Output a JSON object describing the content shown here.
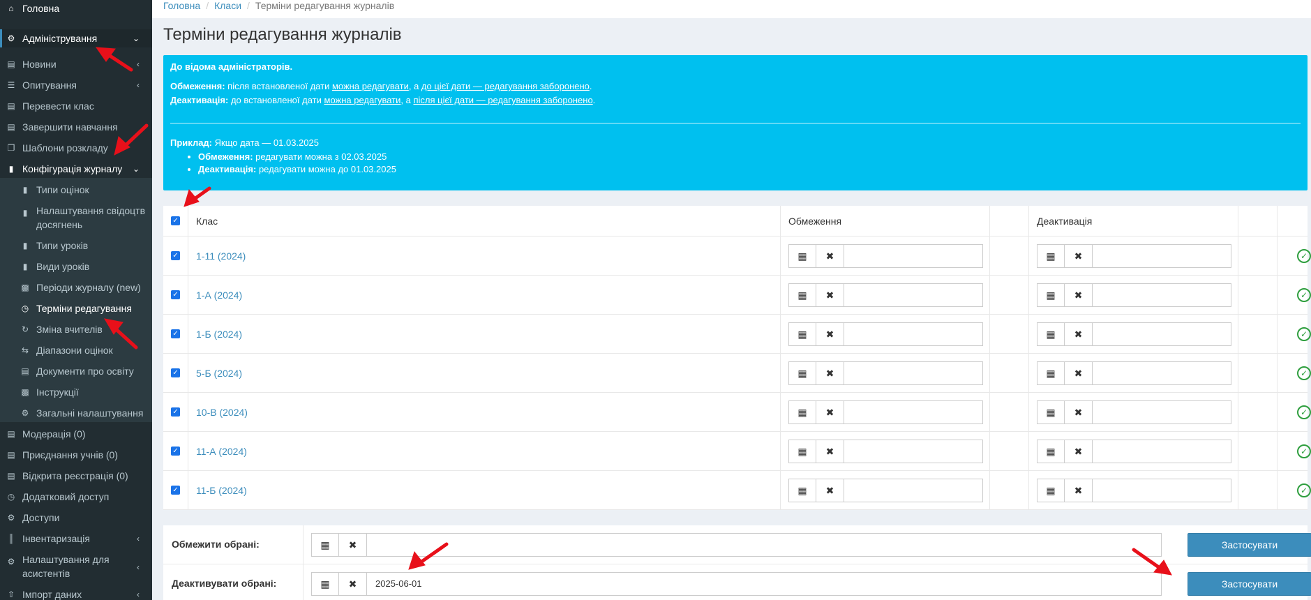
{
  "sidebar": {
    "items": [
      {
        "label": "Головна",
        "icon": "home-icon"
      },
      {
        "label": "Адміністрування",
        "icon": "cogs-icon"
      },
      {
        "label": "Новини",
        "icon": "newspaper-icon"
      },
      {
        "label": "Опитування",
        "icon": "list-icon"
      },
      {
        "label": "Перевести клас",
        "icon": "id-card-icon"
      },
      {
        "label": "Завершити навчання",
        "icon": "id-card-icon"
      },
      {
        "label": "Шаблони розкладу",
        "icon": "copy-icon"
      },
      {
        "label": "Конфігурація журналу",
        "icon": "bookmark-icon"
      },
      {
        "label": "Типи оцінок",
        "icon": "bookmark-icon"
      },
      {
        "label": "Налаштування свідоцтв досягнень",
        "icon": "bookmark-icon"
      },
      {
        "label": "Типи уроків",
        "icon": "bookmark-icon"
      },
      {
        "label": "Види уроків",
        "icon": "bookmark-icon"
      },
      {
        "label": "Періоди журналу (new)",
        "icon": "book-icon"
      },
      {
        "label": "Терміни редагування",
        "icon": "clock-icon"
      },
      {
        "label": "Зміна вчителів",
        "icon": "refresh-icon"
      },
      {
        "label": "Діапазони оцінок",
        "icon": "exchange-icon"
      },
      {
        "label": "Документи про освіту",
        "icon": "id-card-icon"
      },
      {
        "label": "Інструкції",
        "icon": "book-icon"
      },
      {
        "label": "Загальні налаштування",
        "icon": "gear-icon"
      },
      {
        "label": "Модерація (0)",
        "icon": "newspaper-icon"
      },
      {
        "label": "Приєднання учнів (0)",
        "icon": "id-card-icon"
      },
      {
        "label": "Відкрита реєстрація (0)",
        "icon": "id-card-icon"
      },
      {
        "label": "Додатковий доступ",
        "icon": "clock-icon"
      },
      {
        "label": "Доступи",
        "icon": "gear-icon"
      },
      {
        "label": "Інвентаризація",
        "icon": "barcode-icon"
      },
      {
        "label": "Налаштування для асистентів",
        "icon": "gear-icon"
      },
      {
        "label": "Імпорт даних",
        "icon": "upload-icon"
      }
    ]
  },
  "breadcrumb": {
    "home": "Головна",
    "classes": "Класи",
    "current": "Терміни редагування журналів",
    "sep": "/"
  },
  "page_title": "Терміни редагування журналів",
  "callout": {
    "heading": "До відома адміністраторів.",
    "l1_b": "Обмеження:",
    "l1_a": " після встановленої дати ",
    "l1_u1": "можна редагувати",
    "l1_c": ", а ",
    "l1_u2": "до цієї дати — редагування заборонено",
    "l1_d": ".",
    "l2_b": "Деактивація:",
    "l2_a": " до встановленої дати ",
    "l2_u1": "можна редагувати",
    "l2_c": ", а ",
    "l2_u2": "після цієї дати — редагування заборонено",
    "l2_d": ".",
    "ex_b": "Приклад:",
    "ex_t": " Якщо дата — 01.03.2025",
    "b1_b": "Обмеження:",
    "b1_t": " редагувати можна з 02.03.2025",
    "b2_b": "Деактивація:",
    "b2_t": " редагувати можна до 01.03.2025"
  },
  "table": {
    "headers": {
      "class": "Клас",
      "restriction": "Обмеження",
      "deactivation": "Деактивація"
    },
    "rows": [
      {
        "name": "1-11 (2024)"
      },
      {
        "name": "1-А (2024)"
      },
      {
        "name": "1-Б (2024)"
      },
      {
        "name": "5-Б (2024)"
      },
      {
        "name": "10-В (2024)"
      },
      {
        "name": "11-А (2024)"
      },
      {
        "name": "11-Б (2024)"
      }
    ]
  },
  "bulk": {
    "restrict_label": "Обмежити обрані:",
    "restrict_value": "",
    "deactivate_label": "Деактивувати обрані:",
    "deactivate_value": "2025-06-01",
    "apply": "Застосувати"
  },
  "icons": {
    "calendar": "calendar-icon",
    "clear": "times-icon",
    "ok": "check-circle-icon"
  },
  "colors": {
    "sidebar": "#222d32",
    "callout": "#00c0ef",
    "link": "#3c8dbc",
    "button": "#3c8dbc",
    "ok": "#2e9e3e",
    "arrow": "#e8101a"
  }
}
